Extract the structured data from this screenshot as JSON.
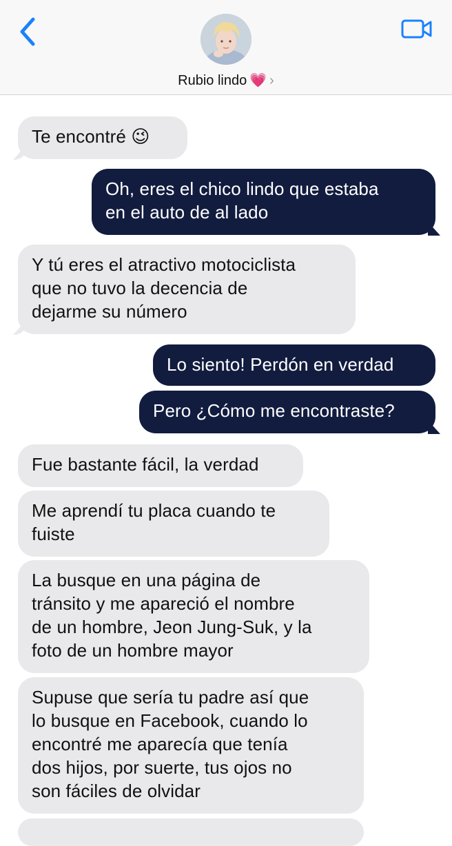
{
  "header": {
    "contact_name": "Rubio lindo",
    "heart_emoji": "💗",
    "chevron": "›",
    "icons": [
      "back-chevron-icon",
      "video-camera-icon",
      "avatar-photo"
    ]
  },
  "colors": {
    "accent": "#1a82fb",
    "sent_bubble": "#121c3f",
    "received_bubble": "#e9e9eb"
  },
  "messages": [
    {
      "from": "them",
      "lines": [
        "Te encontré 😉"
      ]
    },
    {
      "from": "me",
      "lines": [
        "Oh, eres el chico lindo que estaba",
        "en el auto de al lado"
      ]
    },
    {
      "from": "them",
      "lines": [
        "Y tú eres el atractivo motociclista",
        "que no tuvo la decencia de",
        "dejarme su número"
      ]
    },
    {
      "from": "me",
      "lines": [
        "Lo siento! Perdón en verdad"
      ]
    },
    {
      "from": "me",
      "lines": [
        "Pero ¿Cómo me encontraste?"
      ]
    },
    {
      "from": "them",
      "lines": [
        "Fue bastante fácil, la verdad"
      ]
    },
    {
      "from": "them",
      "lines": [
        "Me aprendí tu placa cuando te",
        "fuiste"
      ]
    },
    {
      "from": "them",
      "lines": [
        "La busque en una página de",
        "tránsito y me apareció el nombre",
        "de un hombre, Jeon Jung-Suk, y la",
        "foto de un hombre mayor"
      ]
    },
    {
      "from": "them",
      "lines": [
        "Supuse que sería tu padre así que",
        "lo busque en Facebook, cuando lo",
        "encontré me aparecía que tenía",
        "dos hijos, por suerte, tus ojos no",
        "son fáciles de olvidar"
      ]
    }
  ]
}
